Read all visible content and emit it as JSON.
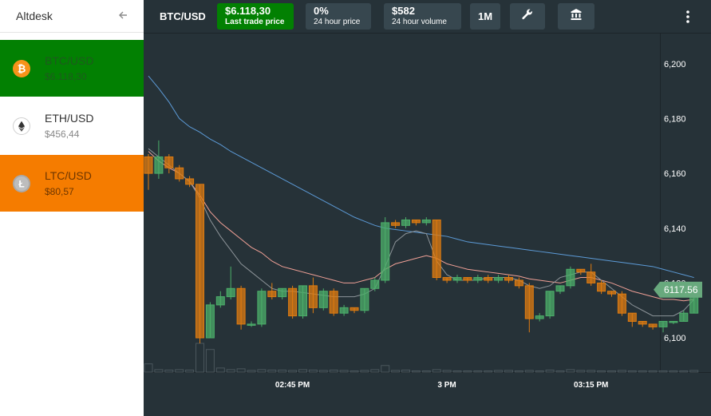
{
  "sidebar": {
    "title": "Altdesk",
    "back_icon": "arrow-left-icon",
    "items": [
      {
        "pair": "BTC/USD",
        "price": "$6.118,30",
        "icon": "bitcoin-icon",
        "bg": "#028002",
        "fg": "#1e5a1e",
        "coin": "#f7931a"
      },
      {
        "pair": "ETH/USD",
        "price": "$456,44",
        "icon": "ethereum-icon",
        "bg": "#ffffff",
        "fg": "#333333",
        "coin": "#ffffff"
      },
      {
        "pair": "LTC/USD",
        "price": "$80,57",
        "icon": "litecoin-icon",
        "bg": "#f57c00",
        "fg": "#6e3600",
        "coin": "#9e9e9e"
      }
    ]
  },
  "topbar": {
    "pair": "BTC/USD",
    "last_price": {
      "value": "$6.118,30",
      "label": "Last trade price",
      "color": "#028002"
    },
    "change": {
      "value": "0%",
      "label": "24 hour price"
    },
    "volume": {
      "value": "$582",
      "label": "24 hour volume"
    },
    "interval": "1M",
    "tools_icon": "wrench-icon",
    "exchange_icon": "bank-icon",
    "menu_icon": "more-vertical-icon"
  },
  "chart_data": {
    "type": "candlestick",
    "x_ticks": [
      "02:45 PM",
      "3 PM",
      "03:15 PM"
    ],
    "y_ticks": [
      "6,200",
      "6,180",
      "6,160",
      "6,140",
      "6,120",
      "6,100"
    ],
    "ylim": [
      6087.5,
      6211
    ],
    "current_price_label": "6117.56",
    "current_price": 6117.56,
    "up_color": "#4caf6a",
    "down_color": "#e07c10",
    "candles": [
      [
        6166,
        6160,
        6167,
        6154,
        20
      ],
      [
        6160,
        6166,
        6172,
        6158,
        6
      ],
      [
        6166,
        6162,
        6167,
        6160,
        5
      ],
      [
        6162,
        6158,
        6163,
        6157,
        6
      ],
      [
        6158,
        6156,
        6159,
        6155,
        5
      ],
      [
        6156,
        6100,
        6156,
        6098,
        70
      ],
      [
        6100,
        6112,
        6113,
        6100,
        55
      ],
      [
        6112,
        6115,
        6117,
        6111,
        10
      ],
      [
        6115,
        6118,
        6126,
        6114,
        6
      ],
      [
        6118,
        6105,
        6119,
        6103,
        8
      ],
      [
        6105,
        6105,
        6106,
        6104,
        4
      ],
      [
        6105,
        6117,
        6118,
        6104,
        6
      ],
      [
        6117,
        6115,
        6120,
        6114,
        5
      ],
      [
        6115,
        6118,
        6118,
        6114,
        5
      ],
      [
        6118,
        6108,
        6119,
        6107,
        4
      ],
      [
        6108,
        6119,
        6119,
        6107,
        6
      ],
      [
        6119,
        6111,
        6122,
        6109,
        5
      ],
      [
        6111,
        6117,
        6118,
        6110,
        4
      ],
      [
        6117,
        6109,
        6118,
        6108,
        5
      ],
      [
        6109,
        6111,
        6112,
        6108,
        4
      ],
      [
        6111,
        6110,
        6111,
        6109,
        3
      ],
      [
        6110,
        6118,
        6118,
        6109,
        4
      ],
      [
        6118,
        6121,
        6122,
        6117,
        6
      ],
      [
        6121,
        6142,
        6144,
        6120,
        16
      ],
      [
        6142,
        6141,
        6143,
        6140,
        4
      ],
      [
        6141,
        6143,
        6144,
        6140,
        5
      ],
      [
        6143,
        6142,
        6143,
        6141,
        3
      ],
      [
        6142,
        6143,
        6144,
        6141,
        3
      ],
      [
        6143,
        6122,
        6143,
        6121,
        6
      ],
      [
        6122,
        6121,
        6122,
        6120,
        4
      ],
      [
        6121,
        6122,
        6123,
        6120,
        3
      ],
      [
        6122,
        6121,
        6122,
        6120,
        3
      ],
      [
        6121,
        6122,
        6123,
        6120,
        3
      ],
      [
        6122,
        6121,
        6123,
        6120,
        3
      ],
      [
        6121,
        6122,
        6123,
        6120,
        4
      ],
      [
        6122,
        6121,
        6123,
        6120,
        4
      ],
      [
        6121,
        6119,
        6122,
        6118,
        3
      ],
      [
        6119,
        6107,
        6120,
        6102,
        4
      ],
      [
        6107,
        6108,
        6109,
        6106,
        3
      ],
      [
        6108,
        6117,
        6117,
        6107,
        5
      ],
      [
        6117,
        6119,
        6119,
        6116,
        3
      ],
      [
        6119,
        6125,
        6126,
        6118,
        6
      ],
      [
        6125,
        6124,
        6125,
        6123,
        4
      ],
      [
        6124,
        6120,
        6127,
        6119,
        4
      ],
      [
        6120,
        6117,
        6121,
        6116,
        3
      ],
      [
        6117,
        6116,
        6117,
        6115,
        3
      ],
      [
        6116,
        6109,
        6117,
        6108,
        4
      ],
      [
        6109,
        6106,
        6109,
        6104,
        3
      ],
      [
        6106,
        6105,
        6106,
        6104,
        3
      ],
      [
        6105,
        6104,
        6105,
        6103,
        3
      ],
      [
        6104,
        6106,
        6106,
        6102,
        3
      ],
      [
        6106,
        6106,
        6106,
        6105,
        3
      ],
      [
        6106,
        6109,
        6110,
        6106,
        3
      ],
      [
        6109,
        6118,
        6120,
        6109,
        4
      ]
    ],
    "series": [
      {
        "name": "",
        "color": "#5c9ad6",
        "values": [
          6195.5,
          6191,
          6186,
          6180,
          6177,
          6175,
          6172.5,
          6170.5,
          6168,
          6166,
          6164,
          6162,
          6160,
          6158,
          6156,
          6154,
          6152,
          6150,
          6148,
          6146,
          6144,
          6142.5,
          6141,
          6140,
          6139.5,
          6139,
          6138.5,
          6138,
          6137.5,
          6137,
          6136,
          6135,
          6134.5,
          6134,
          6133.5,
          6133,
          6132.5,
          6132,
          6131.5,
          6131,
          6130.5,
          6130,
          6129.5,
          6129,
          6128.5,
          6128,
          6127.5,
          6127,
          6126.5,
          6126,
          6125,
          6124,
          6123,
          6122
        ]
      },
      {
        "name": "",
        "color": "#f0a096",
        "values": [
          6168,
          6164.5,
          6162,
          6160,
          6157,
          6152,
          6146,
          6142,
          6139,
          6136,
          6133,
          6131,
          6128,
          6126,
          6125,
          6124,
          6123,
          6122,
          6121,
          6120,
          6120,
          6121,
          6122,
          6125,
          6127,
          6128,
          6129,
          6130,
          6129,
          6127,
          6126,
          6125,
          6124.5,
          6124,
          6123.5,
          6123,
          6122.5,
          6121.5,
          6121,
          6120.5,
          6120,
          6121,
          6122,
          6122,
          6121,
          6120,
          6118.5,
          6117,
          6116,
          6115,
          6114,
          6114,
          6113.5,
          6114
        ]
      },
      {
        "name": "",
        "color": "#8d9499",
        "values": [
          6169,
          6166,
          6163,
          6160,
          6157,
          6151,
          6143,
          6137,
          6132,
          6127,
          6124,
          6121,
          6118,
          6117,
          6117,
          6116.5,
          6116,
          6115.5,
          6115,
          6115,
          6115,
          6116,
          6118,
          6126,
          6135,
          6138,
          6139,
          6138,
          6128,
          6123,
          6121,
          6121,
          6121,
          6122,
          6122,
          6122,
          6121,
          6119,
          6118,
          6119,
          6122,
          6123,
          6124,
          6124,
          6121,
          6118,
          6115,
          6112,
          6110,
          6108,
          6108,
          6108,
          6110,
          6114
        ]
      }
    ]
  }
}
